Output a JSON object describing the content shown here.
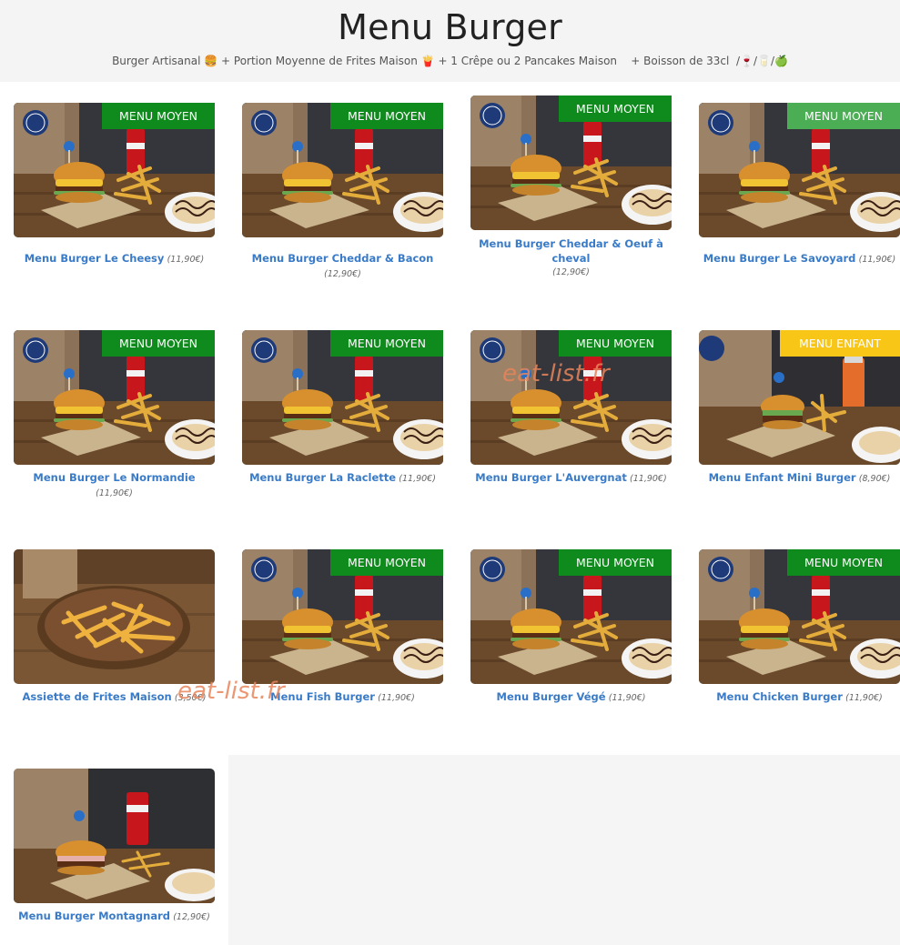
{
  "page": {
    "title": "Menu Burger",
    "subtitle": "Burger Artisanal 🍔 + Portion Moyenne de Frites Maison 🍟 + 1 Crêpe ou 2 Pancakes Maison    + Boisson de 33cl  /🍷/🥛/🍏"
  },
  "watermarks": [
    "eat-list.fr",
    "eat-list.fr"
  ],
  "colors": {
    "badge_green": "#0f8a1c",
    "badge_light_green": "#4cae54",
    "badge_yellow": "#f7c617",
    "link_blue": "#3a7bc8"
  },
  "items": [
    {
      "name": "Menu Burger Le Cheesy",
      "price": "(11,90€)",
      "badge": "MENU MOYEN"
    },
    {
      "name": "Menu Burger Cheddar & Bacon",
      "price": "(12,90€)",
      "badge": "MENU MOYEN"
    },
    {
      "name": "Menu Burger Cheddar & Oeuf à cheval",
      "price": "(12,90€)",
      "badge": "MENU MOYEN"
    },
    {
      "name": "Menu Burger Le Savoyard",
      "price": "(11,90€)",
      "badge": "MENU MOYEN"
    },
    {
      "name": "Menu Burger Le Normandie",
      "price": "(11,90€)",
      "badge": "MENU MOYEN"
    },
    {
      "name": "Menu Burger La Raclette",
      "price": "(11,90€)",
      "badge": "MENU MOYEN"
    },
    {
      "name": "Menu Burger L'Auvergnat",
      "price": "(11,90€)",
      "badge": "MENU MOYEN"
    },
    {
      "name": "Menu Enfant Mini Burger",
      "price": "(8,90€)",
      "badge": "MENU ENFANT"
    },
    {
      "name": "Assiette de Frites Maison",
      "price": "(3,50€)",
      "badge": ""
    },
    {
      "name": "Menu Fish Burger",
      "price": "(11,90€)",
      "badge": "MENU MOYEN"
    },
    {
      "name": "Menu Burger Végé",
      "price": "(11,90€)",
      "badge": "MENU MOYEN"
    },
    {
      "name": "Menu Chicken Burger",
      "price": "(11,90€)",
      "badge": "MENU MOYEN"
    },
    {
      "name": "Menu Burger Montagnard",
      "price": "(12,90€)",
      "badge": ""
    }
  ]
}
